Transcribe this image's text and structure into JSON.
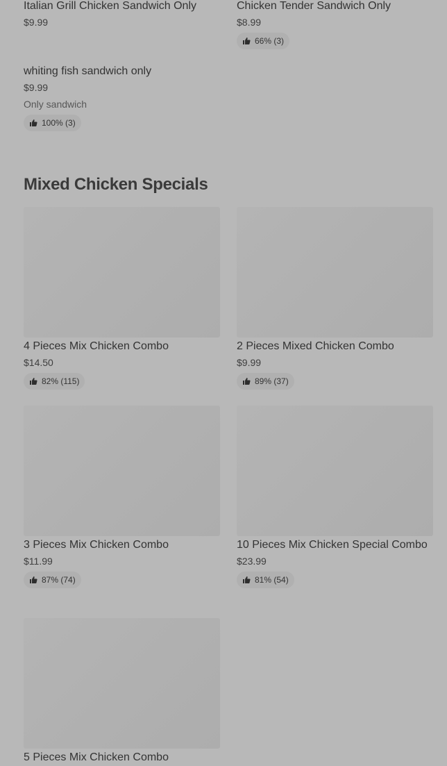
{
  "previous_items": [
    {
      "name": "Italian Grill Chicken Sandwich Only",
      "price": "$9.99"
    },
    {
      "name": "Chicken Tender Sandwich Only",
      "price": "$8.99",
      "rating": "66% (3)"
    },
    {
      "name": "whiting fish sandwich only",
      "price": "$9.99",
      "description": "Only sandwich",
      "rating": "100% (3)"
    }
  ],
  "section": {
    "title": "Mixed Chicken Specials",
    "items": [
      {
        "name": "4 Pieces Mix Chicken Combo",
        "price": "$14.50",
        "rating": "82% (115)"
      },
      {
        "name": "2 Pieces Mixed Chicken Combo",
        "price": "$9.99",
        "rating": "89% (37)"
      },
      {
        "name": "3 Pieces Mix Chicken Combo",
        "price": "$11.99",
        "rating": "87% (74)"
      },
      {
        "name": "10 Pieces Mix Chicken Special Combo",
        "price": "$23.99",
        "rating": "81% (54)"
      },
      {
        "name": "5 Pieces Mix Chicken Combo"
      }
    ]
  },
  "icons": {
    "rating": "thumbs-up-icon"
  },
  "colors": {
    "overlay": "#b8b8b8",
    "image_placeholder": "#b2b2b2",
    "pill": "#b0b0b0"
  }
}
